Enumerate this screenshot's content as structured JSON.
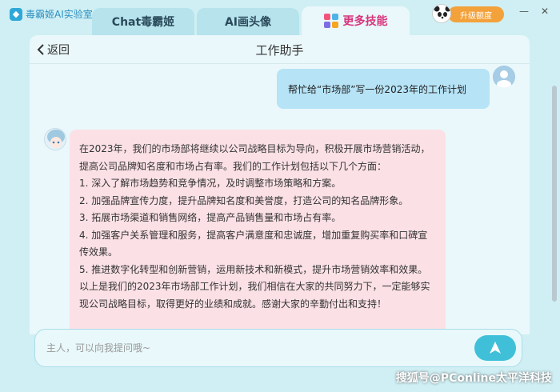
{
  "app": {
    "brand": "毒霸姬AI实验室"
  },
  "tabs": [
    {
      "label": "Chat毒霸姬"
    },
    {
      "label": "AI画头像"
    },
    {
      "label": "更多技能"
    }
  ],
  "account": {
    "upgrade_label": "升级额度"
  },
  "window": {
    "minimize": "—",
    "close": "✕"
  },
  "header": {
    "back_label": "返回",
    "title": "工作助手"
  },
  "messages": {
    "user": "帮忙给“市场部”写一份2023年的工作计划",
    "bot": [
      "在2023年，我们的市场部将继续以公司战略目标为导向，积极开展市场营销活动，提高公司品牌知名度和市场占有率。我们的工作计划包括以下几个方面：",
      "1. 深入了解市场趋势和竞争情况，及时调整市场策略和方案。",
      "2. 加强品牌宣传力度，提升品牌知名度和美誉度，打造公司的知名品牌形象。",
      "3. 拓展市场渠道和销售网络，提高产品销售量和市场占有率。",
      "4. 加强客户关系管理和服务，提高客户满意度和忠诚度，增加重复购买率和口碑宣传效果。",
      "5. 推进数字化转型和创新营销，运用新技术和新模式，提升市场营销效率和效果。",
      "以上是我们的2023年市场部工作计划，我们相信在大家的共同努力下，一定能够实现公司战略目标，取得更好的业绩和成就。感谢大家的辛勤付出和支持！"
    ]
  },
  "input": {
    "placeholder": "主人，可以向我提问哦~"
  },
  "watermark": "搜狐号@PConline太平洋科技",
  "colors": {
    "background": "#cfeff4",
    "accent": "#3fc0d8",
    "user_bubble": "#b6e3f6",
    "bot_bubble": "#fbe1e6",
    "highlight_tab": "#d8357c",
    "upgrade": "#f3a13a"
  }
}
